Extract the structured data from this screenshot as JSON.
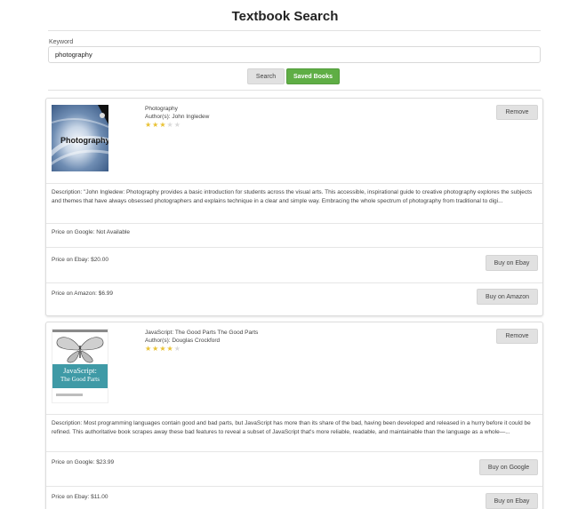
{
  "title": "Textbook Search",
  "search": {
    "label": "Keyword",
    "value": "photography",
    "search_button": "Search",
    "saved_button": "Saved Books"
  },
  "colors": {
    "accent_green": "#5fae45",
    "star_filled": "#e9c233",
    "star_empty": "#dadada"
  },
  "books": [
    {
      "title": "Photography",
      "authors": "Author(s): John Ingledew",
      "rating": 3,
      "max_rating": 5,
      "cover_title": "Photography",
      "remove_label": "Remove",
      "description": "Description: \"John Ingledew: Photography provides a basic introduction for students across the visual arts. This accessible, inspirational guide to creative photography explores the subjects and themes that have always obsessed photographers and explains technique in a clear and simple way. Embracing the whole spectrum of photography from traditional to digi...",
      "price_google": "Price on Google: Not Available",
      "price_ebay": "Price on Ebay: $20.00",
      "buy_ebay": "Buy on Ebay",
      "price_amazon": "Price on Amazon: $6.99",
      "buy_amazon": "Buy on Amazon"
    },
    {
      "title": "JavaScript: The Good Parts The Good Parts",
      "authors": "Author(s): Douglas Crockford",
      "rating": 4,
      "max_rating": 5,
      "cover_title": "JavaScript:",
      "cover_subtitle": "The Good Parts",
      "remove_label": "Remove",
      "description": "Description: Most programming languages contain good and bad parts, but JavaScript has more than its share of the bad, having been developed and released in a hurry before it could be refined. This authoritative book scrapes away these bad features to reveal a subset of JavaScript that's more reliable, readable, and maintainable than the language as a whole—...",
      "price_google": "Price on Google: $23.99",
      "buy_google": "Buy on Google",
      "price_ebay": "Price on Ebay: $11.00",
      "buy_ebay": "Buy on Ebay"
    }
  ]
}
